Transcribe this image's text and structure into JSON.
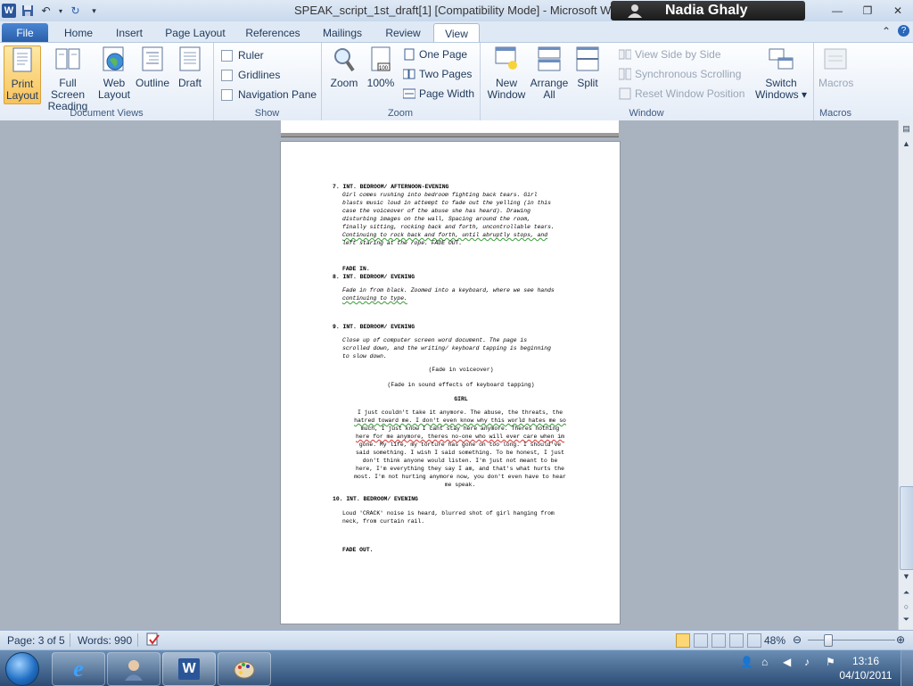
{
  "window": {
    "title": "SPEAK_script_1st_draft[1] [Compatibility Mode]  -  Microsoft Word",
    "user_name": "Nadia Ghaly",
    "app_icon_letter": "W"
  },
  "tabs": [
    {
      "label": "File",
      "selected": false
    },
    {
      "label": "Home",
      "selected": false
    },
    {
      "label": "Insert",
      "selected": false
    },
    {
      "label": "Page Layout",
      "selected": false
    },
    {
      "label": "References",
      "selected": false
    },
    {
      "label": "Mailings",
      "selected": false
    },
    {
      "label": "Review",
      "selected": false
    },
    {
      "label": "View",
      "selected": true
    }
  ],
  "ribbon": {
    "document_views": {
      "label": "Document Views",
      "buttons": [
        "Print\nLayout",
        "Full Screen\nReading",
        "Web\nLayout",
        "Outline",
        "Draft"
      ],
      "print_layout_l1": "Print",
      "print_layout_l2": "Layout",
      "full_screen_l1": "Full Screen",
      "full_screen_l2": "Reading",
      "web_layout_l1": "Web",
      "web_layout_l2": "Layout",
      "outline": "Outline",
      "draft": "Draft"
    },
    "show": {
      "label": "Show",
      "ruler": "Ruler",
      "gridlines": "Gridlines",
      "navigation_pane": "Navigation Pane"
    },
    "zoom": {
      "label": "Zoom",
      "zoom": "Zoom",
      "hundred": "100%",
      "one_page": "One Page",
      "two_pages": "Two Pages",
      "page_width": "Page Width"
    },
    "window": {
      "label": "Window",
      "new_window_l1": "New",
      "new_window_l2": "Window",
      "arrange_l1": "Arrange",
      "arrange_l2": "All",
      "split": "Split",
      "view_side_by_side": "View Side by Side",
      "sync_scrolling": "Synchronous Scrolling",
      "reset_position": "Reset Window Position",
      "switch_l1": "Switch",
      "switch_l2": "Windows ▾"
    },
    "macros": {
      "label": "Macros",
      "macros": "Macros"
    }
  },
  "document": {
    "s7_heading": "7. INT. BEDROOM/ AFTERNOON-EVENING",
    "s7_l1": "Girl comes rushing into bedroom fighting back tears. Girl",
    "s7_l2": "blasts music loud in attempt to fade out the yelling (in this",
    "s7_l3": "case the voiceover of the abuse she has heard). Drawing",
    "s7_l4": "disturbing images on the wall, Spacing around the room,",
    "s7_l5": "finally sitting, rocking back and forth, uncontrollable tears.",
    "s7_l6": "Continuing to rock back and forth, until abruptly stops, and",
    "s7_l7": "left staring at the rope. FADE OUT.",
    "fade_in": "FADE IN.",
    "s8_heading": "8. INT. BEDROOM/ EVENING",
    "s8_l1": "Fade in from black. Zoomed into a keyboard, where we see hands",
    "s8_l2": "continuing to type.",
    "s9_heading": "9. INT. BEDROOM/ EVENING",
    "s9_l1": "Close up of computer screen word document. The page is",
    "s9_l2": "scrolled down, and the writing/ keyboard tapping is beginning",
    "s9_l3": "to slow down.",
    "paren1": "(Fade in voiceover)",
    "paren2": "(Fade in sound effects of keyboard tapping)",
    "character": "GIRL",
    "d1": "I just couldn't take it anymore. The abuse, the threats, the",
    "d2": "hatred toward me. I don't even know why this world hates me so",
    "d3": "much, I just know I cant stay here anymore. Theres nothing",
    "d4": "here for me anymore, theres no-one who will ever care when im",
    "d5": "gone. My life, my torture has gone on too long. I should've",
    "d6": "said something. I wish I said something. To be honest, I just",
    "d7": "don't think anyone would listen. I'm just not meant to be",
    "d8": "here, I'm everything they say I am, and that's what hurts the",
    "d9": "most. I'm not hurting anymore now, you don't even have to hear",
    "d10": "me speak.",
    "s10_heading": "10.      INT. BEDROOM/ EVENING",
    "s10_l1": "Loud 'CRACK' noise is heard, blurred shot of girl hanging from",
    "s10_l2": "neck, from curtain rail.",
    "fade_out": "FADE OUT."
  },
  "status": {
    "page": "Page: 3 of 5",
    "words": "Words: 990",
    "zoom_percent": "48%",
    "zoom_value": 0.48
  },
  "taskbar": {
    "time": "13:16",
    "date": "04/10/2011"
  }
}
